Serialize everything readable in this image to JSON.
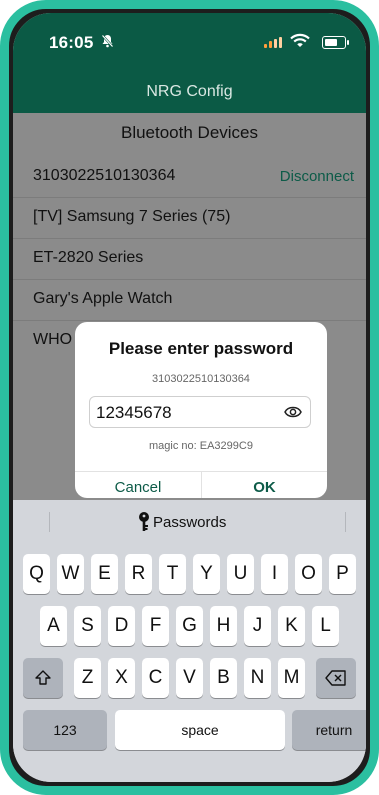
{
  "status": {
    "time": "16:05"
  },
  "nav": {
    "title": "NRG Config"
  },
  "devices": {
    "section_title": "Bluetooth Devices",
    "items": [
      {
        "name": "3103022510130364",
        "action": "Disconnect"
      },
      {
        "name": "[TV] Samsung 7 Series (75)",
        "action": ""
      },
      {
        "name": "ET-2820 Series",
        "action": ""
      },
      {
        "name": "Gary's Apple Watch",
        "action": ""
      },
      {
        "name": "WHO",
        "action": ""
      }
    ]
  },
  "dialog": {
    "title": "Please enter password",
    "device_id": "3103022510130364",
    "password_value": "12345678",
    "magic": "magic no: EA3299C9",
    "cancel_label": "Cancel",
    "ok_label": "OK"
  },
  "keyboard": {
    "suggestion": "Passwords",
    "row1": [
      "Q",
      "W",
      "E",
      "R",
      "T",
      "Y",
      "U",
      "I",
      "O",
      "P"
    ],
    "row2": [
      "A",
      "S",
      "D",
      "F",
      "G",
      "H",
      "J",
      "K",
      "L"
    ],
    "row3": [
      "Z",
      "X",
      "C",
      "V",
      "B",
      "N",
      "M"
    ],
    "numbers_label": "123",
    "space_label": "space",
    "return_label": "return"
  },
  "colors": {
    "accent": "#0d5b48",
    "frame": "#2bbfa0",
    "navbar": "#0b5a45"
  }
}
